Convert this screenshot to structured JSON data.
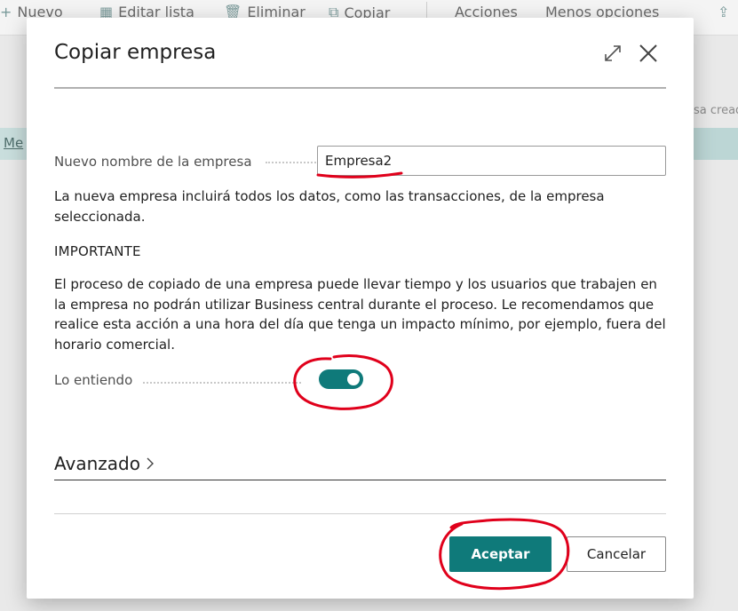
{
  "background": {
    "toolbar": {
      "new_label": "Nuevo",
      "edit_list_label": "Editar lista",
      "delete_label": "Eliminar",
      "copy_label": "Copiar",
      "actions_label": "Acciones",
      "fewer_options_label": "Menos opciones"
    },
    "side_text": "sa cread",
    "band_text": "Me"
  },
  "dialog": {
    "title": "Copiar empresa",
    "new_company_label": "Nuevo nombre de la empresa",
    "new_company_value": "Empresa2",
    "info_text": "La nueva empresa incluirá todos los datos, como las transacciones, de la empresa seleccionada.",
    "important_heading": "IMPORTANTE",
    "important_text": "El proceso de copiado de una empresa puede llevar tiempo y los usuarios que trabajen en la empresa no podrán utilizar Business central durante el proceso. Le recomendamos que realice esta acción a una hora del día que tenga un impacto mínimo, por ejemplo, fuera del horario comercial.",
    "understand_label": "Lo entiendo",
    "understand_value": true,
    "advanced_label": "Avanzado",
    "ok_label": "Aceptar",
    "cancel_label": "Cancelar"
  },
  "colors": {
    "accent": "#0f7a7a",
    "annotation": "#e0001b"
  },
  "icons": [
    "plus-icon",
    "edit-list-icon",
    "trash-icon",
    "copy-icon",
    "share-icon",
    "expand-icon",
    "close-icon",
    "chevron-right-icon"
  ]
}
